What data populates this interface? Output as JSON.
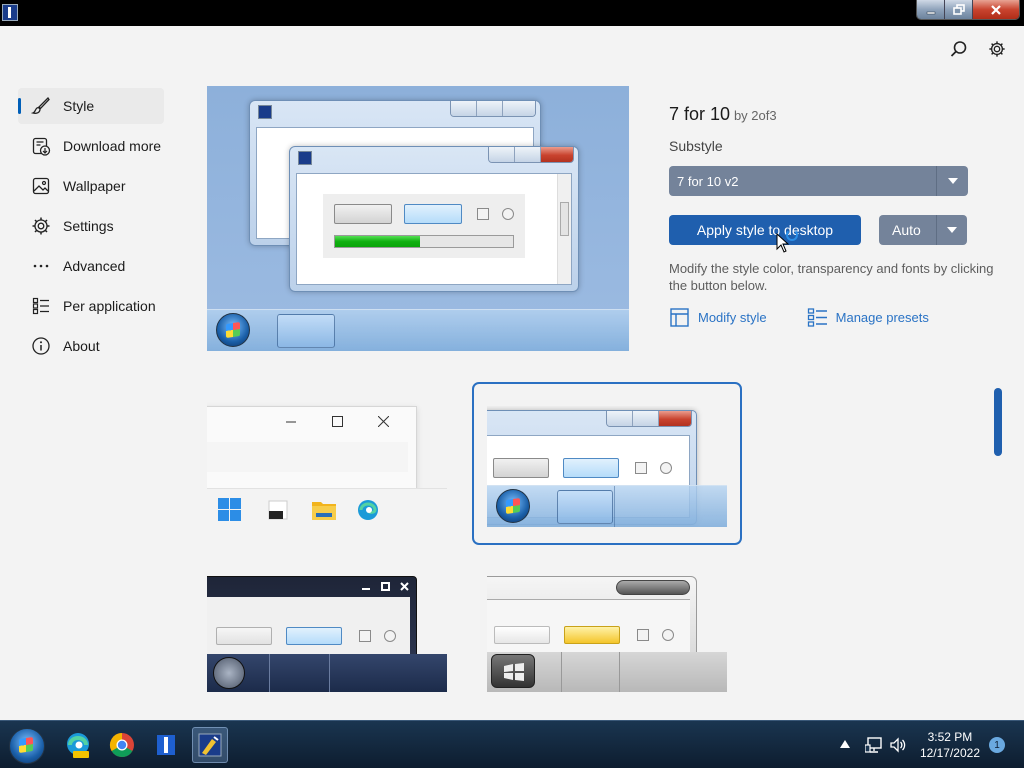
{
  "window": {
    "title": "",
    "buttons": [
      "minimize",
      "restore",
      "close"
    ]
  },
  "toolbar": {
    "icons": [
      "search-icon",
      "gear-icon"
    ]
  },
  "nav": {
    "items": [
      {
        "label": "Style",
        "icon": "brush-icon",
        "active": true
      },
      {
        "label": "Download more s",
        "icon": "download-icon",
        "active": false
      },
      {
        "label": "Wallpaper",
        "icon": "image-icon",
        "active": false
      },
      {
        "label": "Settings",
        "icon": "gear-icon",
        "active": false
      },
      {
        "label": "Advanced",
        "icon": "more-icon",
        "active": false
      },
      {
        "label": "Per application",
        "icon": "list-icon",
        "active": false
      },
      {
        "label": "About",
        "icon": "info-icon",
        "active": false
      }
    ]
  },
  "style": {
    "name": "7 for 10",
    "author": "by 2of3",
    "substyle_label": "Substyle",
    "substyle_value": "7 for 10 v2",
    "apply_label": "Apply style to desktop",
    "auto_label": "Auto",
    "description": "Modify the style color, transparency and fonts by clicking the button below.",
    "modify_label": "Modify style",
    "presets_label": "Manage presets"
  },
  "colors": {
    "accent": "#1f5fae",
    "select_bg": "#74839a",
    "link": "#2a73c5"
  },
  "thumbnails": [
    "Windows 11 style",
    "Windows 7 style (selected)",
    "Dark style",
    "Silver style"
  ],
  "taskbar": {
    "apps": [
      "edge-can-icon",
      "chrome-icon",
      "app-icon",
      "style-app-icon"
    ],
    "time": "3:52 PM",
    "date": "12/17/2022",
    "notification_count": "1"
  }
}
